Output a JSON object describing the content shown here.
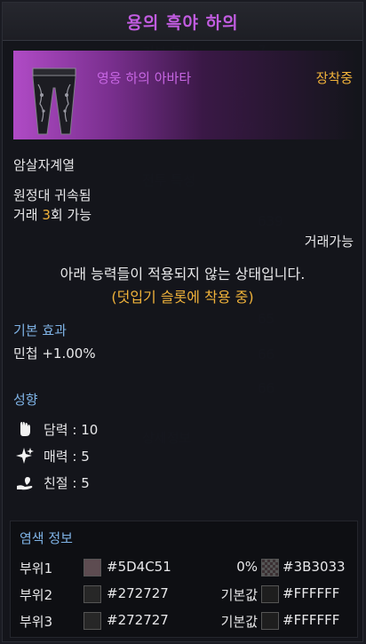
{
  "title": "용의 흑야 하의",
  "item": {
    "name": "영웅 하의 아바타",
    "status": "장착중",
    "icon": "black-stocking-pants-icon"
  },
  "class_restriction": "암살자계열",
  "bind_info": "원정대 귀속됨",
  "trade": {
    "prefix": "거래 ",
    "count": "3",
    "suffix": "회 가능"
  },
  "tradable": "거래가능",
  "notice": {
    "line1": "아래 능력들이 적용되지 않는 상태입니다.",
    "line2": "(덧입기 슬롯에 착용 중)"
  },
  "basic_effect": {
    "heading": "기본 효과",
    "value": "민첩 +1.00%"
  },
  "tendency": {
    "heading": "성향",
    "items": [
      {
        "icon": "fist-icon",
        "label": "담력 : 10"
      },
      {
        "icon": "sparkle-icon",
        "label": "매력 : 5"
      },
      {
        "icon": "heart-hand-icon",
        "label": "친절 : 5"
      }
    ]
  },
  "dye": {
    "heading": "염색 정보",
    "rows": [
      {
        "part": "부위1",
        "color1": "#5D4C51",
        "hex1": "#5D4C51",
        "extra": "0%",
        "color2": "#3B3033",
        "hex2": "#3B3033",
        "patterned": true
      },
      {
        "part": "부위2",
        "color1": "#272727",
        "hex1": "#272727",
        "extra": "기본값",
        "color2": "#FFFFFF",
        "hex2": "#FFFFFF",
        "patterned": false
      },
      {
        "part": "부위3",
        "color1": "#272727",
        "hex1": "#272727",
        "extra": "기본값",
        "color2": "#FFFFFF",
        "hex2": "#FFFFFF",
        "patterned": false
      }
    ]
  },
  "colors": {
    "title": "#C15CE0",
    "rarity": "#C766E3",
    "highlight": "#F0B23A",
    "section": "#7FB3E6"
  }
}
